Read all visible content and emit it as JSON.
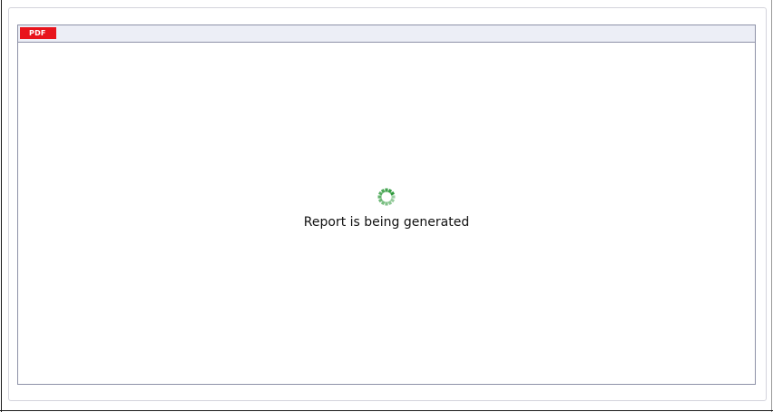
{
  "viewer": {
    "toolbar": {
      "pdf_button_label": "PDF"
    },
    "status": {
      "message": "Report is being generated",
      "spinner_icon": "loading-spinner-icon",
      "spinner_color": "#2f9a3c"
    }
  },
  "colors": {
    "pdf_button": "#e8141c",
    "toolbar_bg": "#eceef6",
    "viewer_border": "#8e92a8"
  }
}
